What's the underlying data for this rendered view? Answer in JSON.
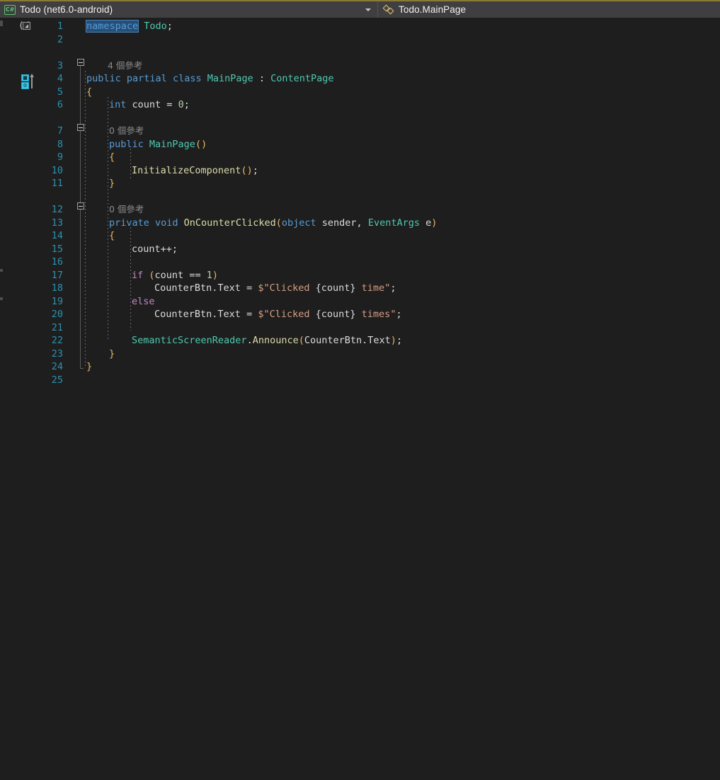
{
  "window": {
    "accent_color": "#8a7a32",
    "background": "#1e1e1e",
    "navbar_background": "#3f3f41"
  },
  "navbar": {
    "project_icon": "csharp-file-icon",
    "project_label": "Todo (net6.0-android)",
    "project_chevron": "chevron-down-icon",
    "type_icon": "class-icon",
    "type_label": "Todo.MainPage",
    "type_chevron": "chevron-down-icon"
  },
  "glyph_margin": {
    "brace_icon_name": "code-snippet-brace-icon",
    "brace_left": "(",
    "brace_right": ")",
    "brace_inner": "◩",
    "intellicode_icon_name": "intellicode-suggestion-icon",
    "intellicode_top": "⬜",
    "intellicode_bottom": "⚙"
  },
  "editor": {
    "line_number_color": "#2b91af",
    "selected_token": "namespace",
    "line_numbers": [
      1,
      2,
      3,
      4,
      5,
      6,
      7,
      8,
      9,
      10,
      11,
      12,
      13,
      14,
      15,
      16,
      17,
      18,
      19,
      20,
      21,
      22,
      23,
      24,
      25
    ],
    "codelens": [
      {
        "id": "class-refs",
        "text": "4 個參考",
        "count": "4",
        "label": "個參考"
      },
      {
        "id": "ctor-refs",
        "text": "0 個參考",
        "count": "0",
        "label": "個參考"
      },
      {
        "id": "oncounter-refs",
        "text": "0 個參考",
        "count": "0",
        "label": "個參考"
      }
    ],
    "lines": {
      "l1": "namespace Todo;",
      "l3": "public partial class MainPage : ContentPage",
      "l4": "{",
      "l5": "int count = 0;",
      "l7": "public MainPage()",
      "l8": "{",
      "l9": "InitializeComponent();",
      "l10": "}",
      "l12": "private void OnCounterClicked(object sender, EventArgs e)",
      "l13": "{",
      "l14": "count++;",
      "l16": "if (count == 1)",
      "l17": "CounterBtn.Text = $\"Clicked {count} time\";",
      "l18": "else",
      "l19": "CounterBtn.Text = $\"Clicked {count} times\";",
      "l21": "SemanticScreenReader.Announce(CounterBtn.Text);",
      "l22": "}",
      "l23": "}"
    },
    "tokens": {
      "namespace": "namespace",
      "todo": " Todo",
      "semi": ";",
      "public": "public",
      "partial": " partial",
      "class": " class",
      "mainpage_type": " MainPage",
      "colon": " : ",
      "contentpage": "ContentPage",
      "int": "int",
      "count_decl": " count ",
      "eq": "= ",
      "zero": "0",
      "mainpage_ctor": " MainPage",
      "initializecomponent": "InitializeComponent",
      "private": "private",
      "void": " void",
      "oncounterclicked": " OnCounterClicked",
      "object": "object",
      "sender": " sender",
      "comma": ", ",
      "eventargs": "EventArgs",
      "e": " e",
      "count_inc": "count++;",
      "if": "if ",
      "count_ref": "count ",
      "eqeq": "== ",
      "one": "1",
      "counterbtn": "CounterBtn",
      "dot_text": ".Text ",
      "assign": "= ",
      "dollar_quote": "$\"",
      "clicked": "Clicked ",
      "brace_open": "{",
      "count_interp": "count",
      "brace_close": "}",
      "time": " time",
      "times": " times",
      "quote": "\"",
      "else": "else",
      "semanticscreenreader": "SemanticScreenReader",
      "dot": ".",
      "announce": "Announce",
      "counterbtn_text": "CounterBtn.Text",
      "paren_open": "(",
      "paren_close": ")",
      "brace_curly_open": "{",
      "brace_curly_close": "}"
    }
  }
}
